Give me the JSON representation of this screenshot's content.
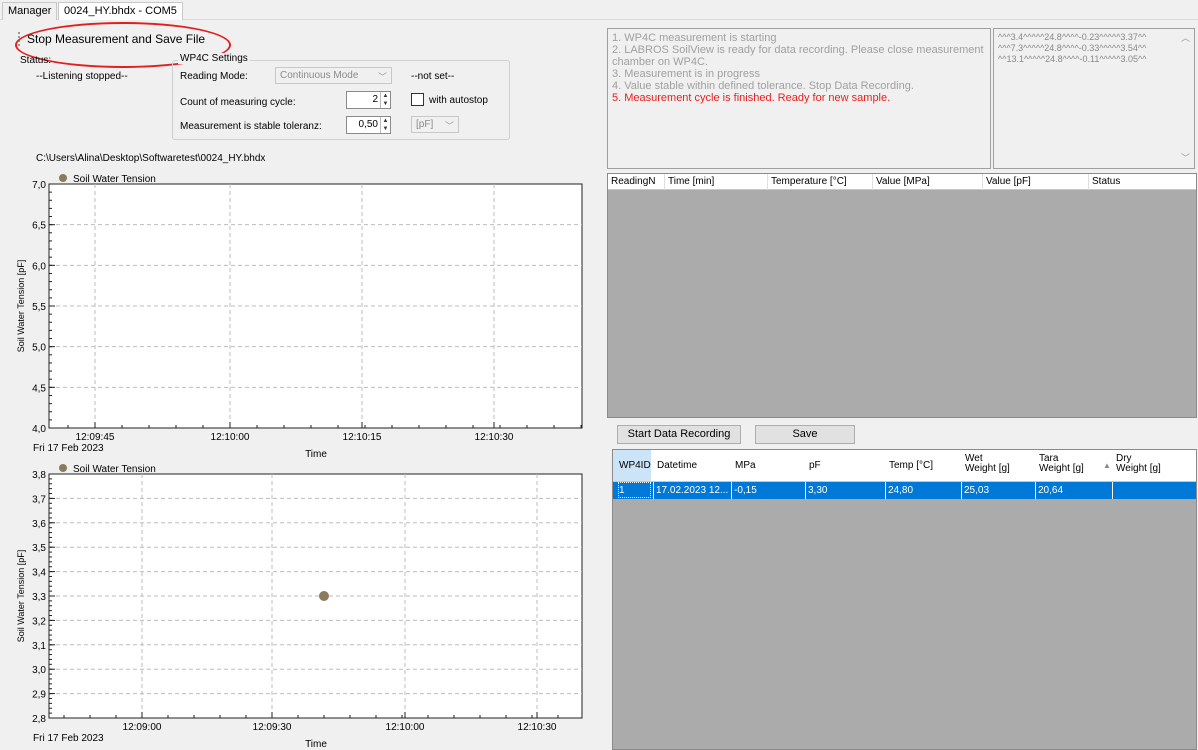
{
  "tabs": [
    {
      "label": "Manager"
    },
    {
      "label": "0024_HY.bhdx - COM5"
    }
  ],
  "toolbar": {
    "stop_label": "Stop Measurement and Save File"
  },
  "status": {
    "label": "Status:",
    "value": "--Listening stopped--"
  },
  "settings": {
    "group_title": "WP4C Settings",
    "reading_mode_label": "Reading Mode:",
    "reading_mode_value": "Continuous Mode",
    "not_set": "--not set--",
    "count_label": "Count of measuring cycle:",
    "count_value": "2",
    "autostop_label": "with autostop",
    "stable_label": "Measurement is stable toleranz:",
    "stable_value": "0,50",
    "unit_value": "[pF]"
  },
  "file_path": "C:\\Users\\Alina\\Desktop\\Softwaretest\\0024_HY.bhdx",
  "messages": [
    {
      "text": "1. WP4C measurement is starting",
      "active": false
    },
    {
      "text": "2. LABROS SoilView is ready for data recording. Please close measurement chamber on WP4C.",
      "active": false
    },
    {
      "text": "3. Measurement is in progress",
      "active": false
    },
    {
      "text": "4. Value stable within defined tolerance. Stop Data Recording.",
      "active": false
    },
    {
      "text": "5. Measurement cycle is finished. Ready for new sample.",
      "active": true
    }
  ],
  "log_lines": [
    "^^^3.4^^^^^24.8^^^^-0.23^^^^^3.37^^",
    "^^^7.3^^^^^24.8^^^^-0.33^^^^^3.54^^",
    "^^13.1^^^^^24.8^^^^-0.11^^^^^3.05^^"
  ],
  "chart_data": [
    {
      "type": "scatter",
      "title": "Soil Water Tension",
      "legend": "Soil Water Tension",
      "xlabel": "Time",
      "ylabel": "Soil Water Tension [pF]",
      "date_label": "Fri 17  Feb 2023",
      "ylim": [
        4.0,
        7.0
      ],
      "yticks": [
        "7,0",
        "6,5",
        "6,0",
        "5,5",
        "5,0",
        "4,5",
        "4,0"
      ],
      "xticks": [
        "12:09:45",
        "12:10:00",
        "12:10:15",
        "12:10:30"
      ],
      "points": [],
      "colors": {
        "marker": "#8b7b5e"
      }
    },
    {
      "type": "scatter",
      "title": "Soil Water Tension",
      "legend": "Soil Water Tension",
      "xlabel": "Time",
      "ylabel": "Soil Water Tension [pF]",
      "date_label": "Fri 17  Feb 2023",
      "ylim": [
        2.8,
        3.8
      ],
      "yticks": [
        "3,8",
        "3,7",
        "3,6",
        "3,5",
        "3,4",
        "3,3",
        "3,2",
        "3,1",
        "3,0",
        "2,9",
        "2,8"
      ],
      "xticks": [
        "12:09:00",
        "12:09:30",
        "12:10:00",
        "12:10:30"
      ],
      "points": [
        {
          "x": "12:09:42",
          "y": 3.3
        }
      ],
      "colors": {
        "marker": "#8b7b5e"
      }
    }
  ],
  "reading_table": {
    "columns": [
      "ReadingN",
      "Time [min]",
      "Temperature [°C]",
      "Value [MPa]",
      "Value [pF]",
      "Status"
    ]
  },
  "buttons": {
    "start_recording": "Start Data Recording",
    "save": "Save"
  },
  "results_table": {
    "columns": [
      "WP4ID",
      "Datetime",
      "MPa",
      "pF",
      "Temp [°C]",
      "Wet Weight [g]",
      "Tara Weight [g]",
      "Dry Weight [g]"
    ],
    "rows": [
      [
        "1",
        "17.02.2023 12...",
        "-0,15",
        "3,30",
        "24,80",
        "25,03",
        "20,64",
        ""
      ]
    ]
  }
}
